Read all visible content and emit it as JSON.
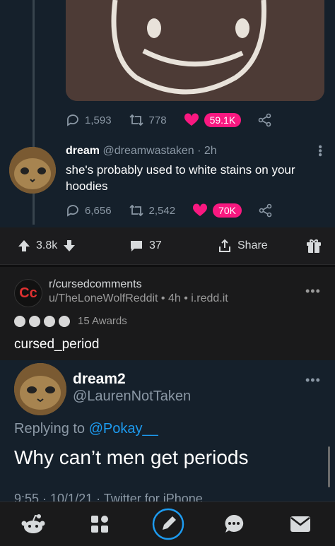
{
  "tweet1": {
    "replies": "1,593",
    "retweets": "778",
    "likes": "59.1K"
  },
  "tweet2": {
    "name": "dream",
    "handle": "@dreamwastaken",
    "time": "· 2h",
    "text": "she's probably used to white stains on your hoodies",
    "replies": "6,656",
    "retweets": "2,542",
    "likes": "70K"
  },
  "actionbar": {
    "votes": "3.8k",
    "comments": "37",
    "share": "Share"
  },
  "post": {
    "subreddit": "r/cursedcomments",
    "meta": "u/TheLoneWolfReddit • 4h • i.redd.it",
    "awards": "15 Awards",
    "title": "cursed_period",
    "sub_icon": "Cc"
  },
  "tweet3": {
    "name": "dream2",
    "handle": "@LaurenNotTaken",
    "reply_prefix": "Replying to",
    "reply_to": "@Pokay__",
    "text": "Why can’t men get periods",
    "time": "9:55 · 10/1/21 · Twitter for iPhone"
  },
  "colors": {
    "twitter_bg": "#15202b",
    "reddit_bg": "#1a1a1b",
    "like": "#f91880",
    "link": "#1d9bf0"
  }
}
